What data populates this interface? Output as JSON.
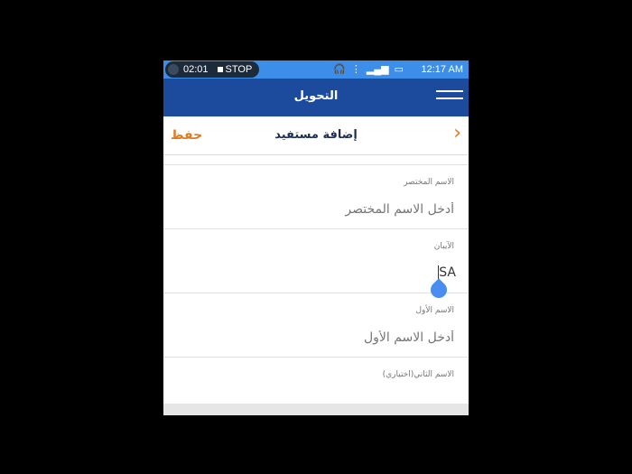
{
  "status_bar": {
    "recording_time": "02:01",
    "stop_label": "STOP",
    "clock": "12:17 AM",
    "icons": [
      "headset-icon",
      "wifi-icon",
      "signal-icon",
      "signal-icon",
      "battery-icon"
    ],
    "color": "#3d8ee8"
  },
  "app_bar": {
    "title": "التحويل",
    "menu_icon": "hamburger-menu-icon",
    "color": "#1c4a9c"
  },
  "sub_header": {
    "title": "إضافة مستفيد",
    "save_label": "حفظ",
    "back_icon": "chevron-right-icon",
    "accent": "#e07a1f"
  },
  "form": {
    "fields": [
      {
        "label": "الاسم المختصر",
        "placeholder": "أدخل الاسم المختصر",
        "value": ""
      },
      {
        "label": "الآيبان",
        "placeholder": "",
        "value": "SA"
      },
      {
        "label": "الاسم الأول",
        "placeholder": "أدخل الاسم الأول",
        "value": ""
      },
      {
        "label": "الاسم الثاني(اختياري)",
        "placeholder": "",
        "value": ""
      }
    ]
  }
}
